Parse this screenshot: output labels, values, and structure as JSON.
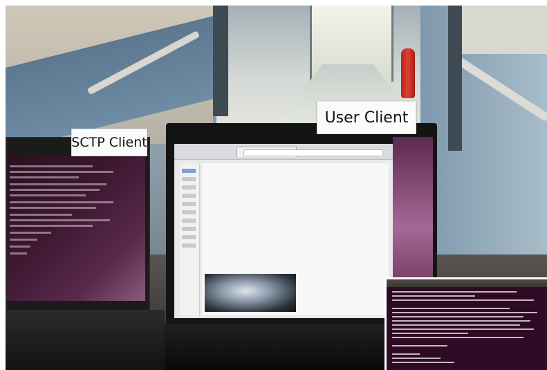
{
  "scene": {
    "labels": {
      "sctp_client": "SCTP Client",
      "user_client": "User Client"
    },
    "colors": {
      "terminal_bg": "#2f0a24",
      "label_paper": "#fbfbfb",
      "extinguisher": "#c9281f"
    },
    "icons": [
      "browser-window-icon"
    ]
  }
}
